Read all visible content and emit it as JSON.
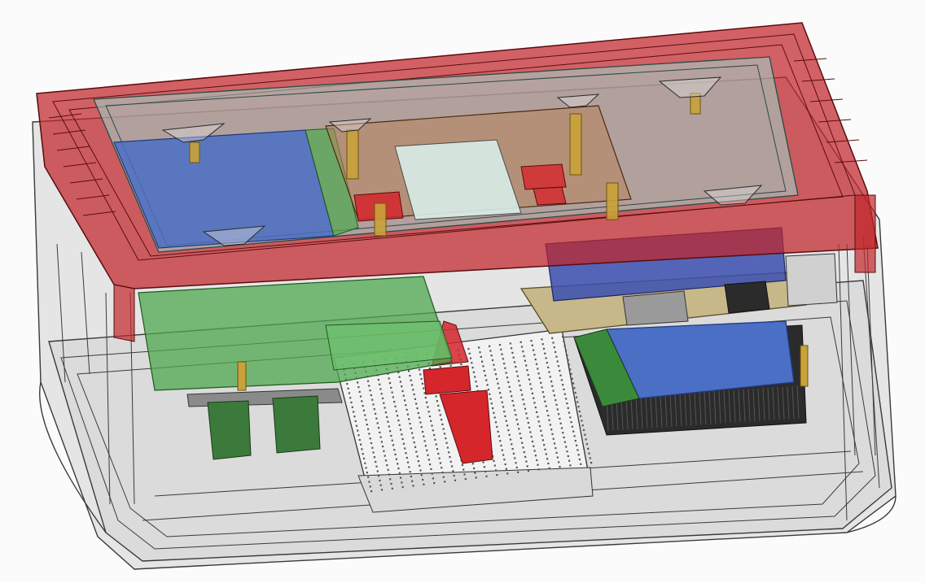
{
  "scene": {
    "kind": "cad-assembly-render",
    "view": "isometric",
    "render_style": "transparent-shaded-with-edges",
    "colors": {
      "background": "#fbfbfb",
      "enclosure": "#c9c9c9",
      "enclosure_edge": "#3a3a3a",
      "lid": "#c0262b",
      "lid_edge": "#5a0c0f",
      "glass": "#9fd8d0",
      "display_panel": "#4a6fc4",
      "green_board": "#4fa84f",
      "raspberry_pi_board": "#c7b88a",
      "breadboard": "#f2f2f2",
      "heatsink": "#2b2b2b",
      "standoff_brass": "#c9a23a",
      "header_red": "#d4262b"
    },
    "components": [
      {
        "name": "enclosure-base",
        "color_key": "enclosure"
      },
      {
        "name": "enclosure-lid",
        "color_key": "lid"
      },
      {
        "name": "clear-window",
        "color_key": "glass"
      },
      {
        "name": "blue-display-module",
        "color_key": "display_panel"
      },
      {
        "name": "hat-board",
        "color_key": "raspberry_pi_board"
      },
      {
        "name": "green-pcb",
        "color_key": "green_board"
      },
      {
        "name": "breadboard",
        "color_key": "breadboard"
      },
      {
        "name": "single-board-computer",
        "color_key": "raspberry_pi_board"
      },
      {
        "name": "blue-heatsink-module",
        "color_key": "display_panel"
      },
      {
        "name": "heatsink-fins",
        "color_key": "heatsink"
      }
    ]
  }
}
